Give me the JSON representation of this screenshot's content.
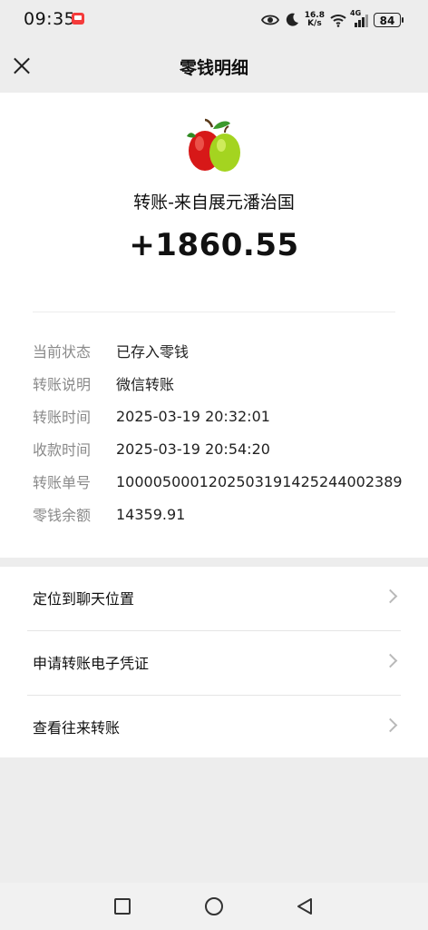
{
  "status_bar": {
    "time": "09:35",
    "speed_top": "16.8",
    "speed_bottom": "K/s",
    "network": "4G",
    "battery": "84"
  },
  "header": {
    "title": "零钱明细"
  },
  "transfer": {
    "from": "转账-来自展元潘治国",
    "amount": "+1860.55"
  },
  "details": [
    {
      "label": "当前状态",
      "value": "已存入零钱"
    },
    {
      "label": "转账说明",
      "value": "微信转账"
    },
    {
      "label": "转账时间",
      "value": "2025-03-19 20:32:01"
    },
    {
      "label": "收款时间",
      "value": "2025-03-19 20:54:20"
    },
    {
      "label": "转账单号",
      "value": "1000050001202503191425244002389"
    },
    {
      "label": "零钱余额",
      "value": "14359.91"
    }
  ],
  "actions": [
    {
      "label": "定位到聊天位置"
    },
    {
      "label": "申请转账电子凭证"
    },
    {
      "label": "查看往来转账"
    }
  ],
  "colors": {
    "background": "#ededed",
    "card": "#ffffff",
    "label_gray": "#8a8a8a"
  }
}
